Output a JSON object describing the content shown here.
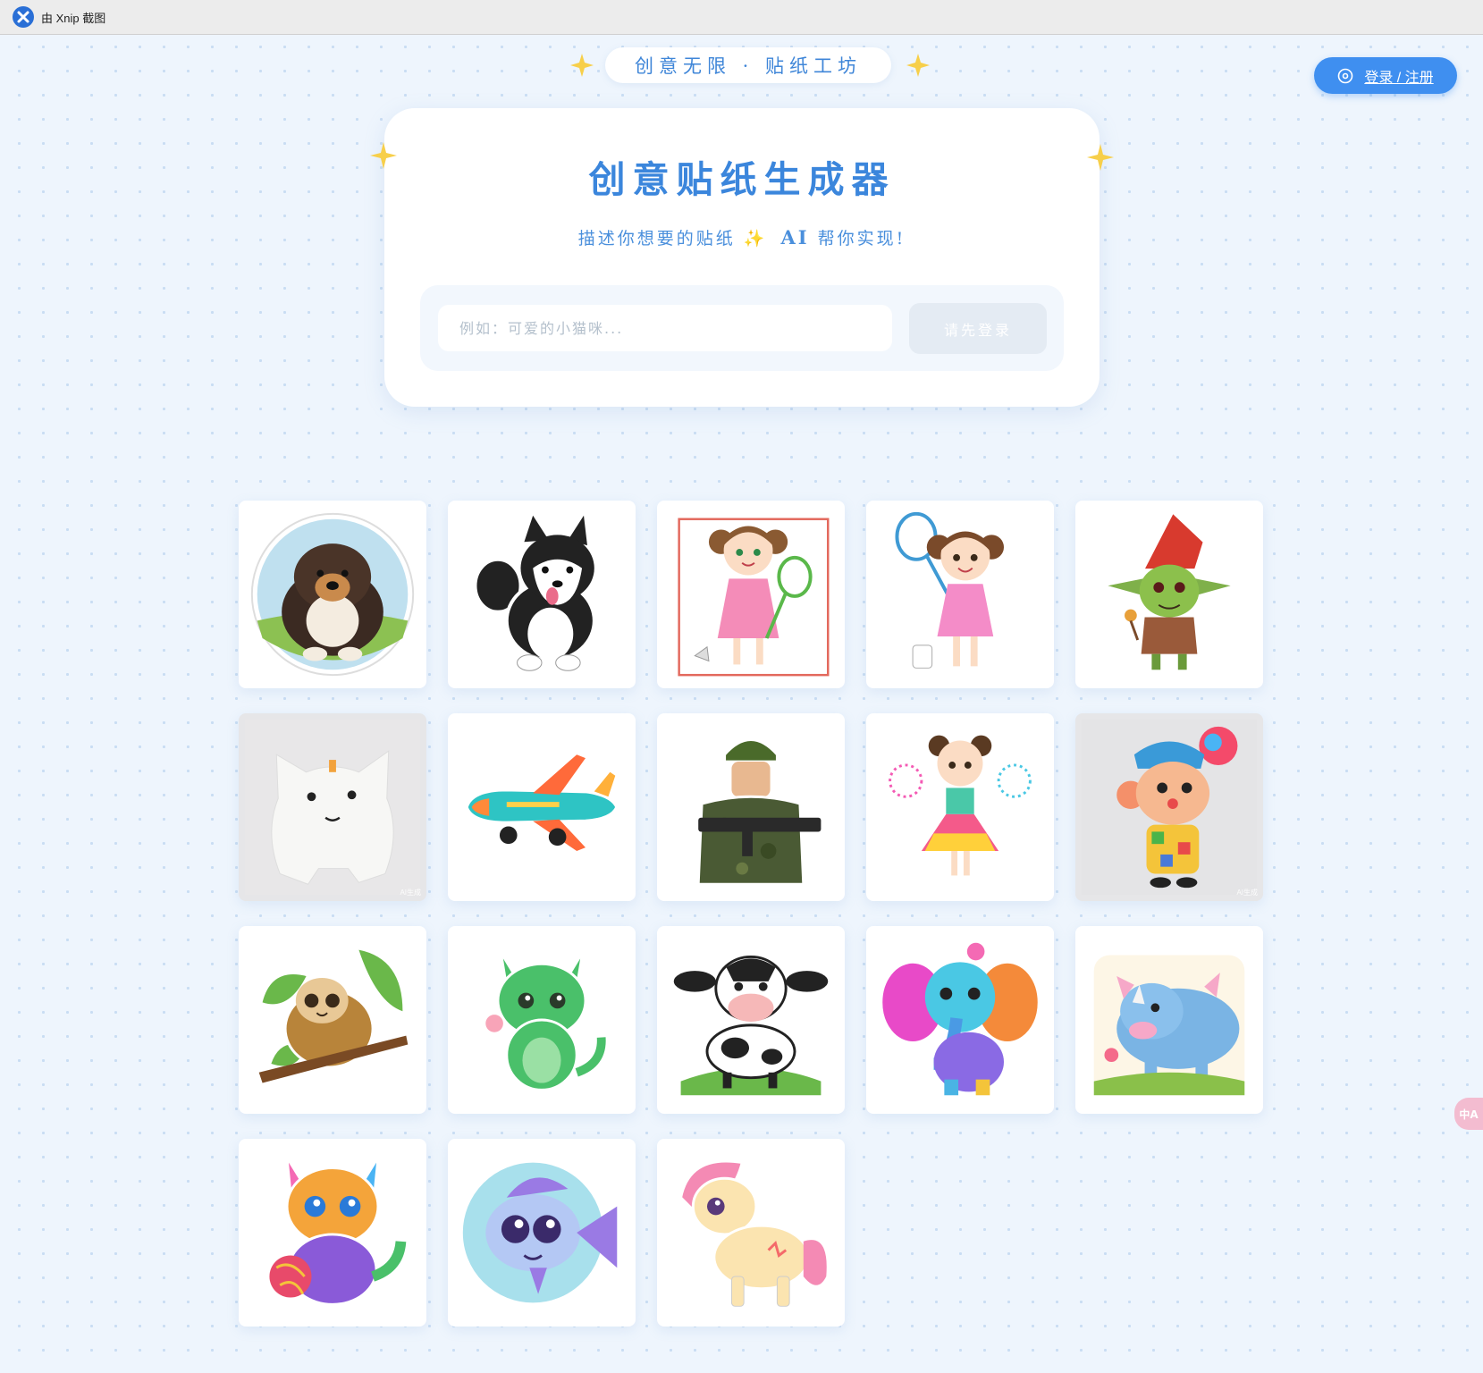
{
  "window": {
    "title": "由 Xnip 截图"
  },
  "header": {
    "badge": "创意无限 · 贴纸工坊",
    "login_label": "登录 / 注册"
  },
  "hero": {
    "title": "创意贴纸生成器",
    "subtitle_pre": "描述你想要的贴纸",
    "subtitle_spark": "✨",
    "subtitle_ai": "AI",
    "subtitle_post": "帮你实现!",
    "input_placeholder": "例如：可爱的小猫咪...",
    "input_value": "",
    "submit_label": "请先登录"
  },
  "gallery": [
    {
      "subject": "dog",
      "watermark": ""
    },
    {
      "subject": "husky",
      "watermark": ""
    },
    {
      "subject": "girl-badminton-framed",
      "watermark": ""
    },
    {
      "subject": "girl-racket",
      "watermark": ""
    },
    {
      "subject": "goblin",
      "watermark": ""
    },
    {
      "subject": "white-blob",
      "watermark": "AI生成"
    },
    {
      "subject": "airplane",
      "watermark": ""
    },
    {
      "subject": "soldier",
      "watermark": ""
    },
    {
      "subject": "girl-sparklers",
      "watermark": ""
    },
    {
      "subject": "clown-monkey",
      "watermark": "AI生成"
    },
    {
      "subject": "sloth",
      "watermark": ""
    },
    {
      "subject": "green-cat",
      "watermark": ""
    },
    {
      "subject": "cow",
      "watermark": ""
    },
    {
      "subject": "elephant",
      "watermark": ""
    },
    {
      "subject": "rhino",
      "watermark": ""
    },
    {
      "subject": "rainbow-kitten",
      "watermark": ""
    },
    {
      "subject": "fish",
      "watermark": ""
    },
    {
      "subject": "pony",
      "watermark": ""
    }
  ],
  "side_tab": {
    "label": "中A"
  },
  "colors": {
    "accent": "#3f8ff0",
    "title": "#3b86dc",
    "background": "#eef5fd"
  }
}
